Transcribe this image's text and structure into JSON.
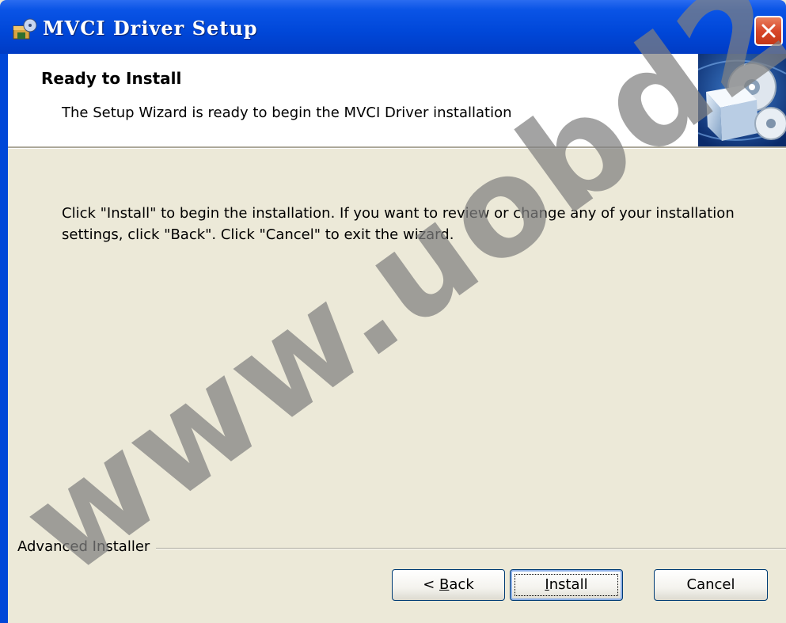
{
  "window": {
    "title": "MVCI Driver Setup"
  },
  "header": {
    "heading": "Ready to Install",
    "subheading": "The Setup Wizard is ready to begin the MVCI Driver installation",
    "banner_icon": "installer-box-cd-icon"
  },
  "body": {
    "instructions": "Click \"Install\" to begin the installation.  If you want to review or change any of your installation settings, click \"Back\".  Click \"Cancel\" to exit the wizard."
  },
  "footer": {
    "brand": "Advanced Installer",
    "buttons": {
      "back_prefix": "< ",
      "back_mnemonic": "B",
      "back_rest": "ack",
      "install_mnemonic": "I",
      "install_rest": "nstall",
      "cancel": "Cancel"
    }
  },
  "watermark": "www.uobd2"
}
